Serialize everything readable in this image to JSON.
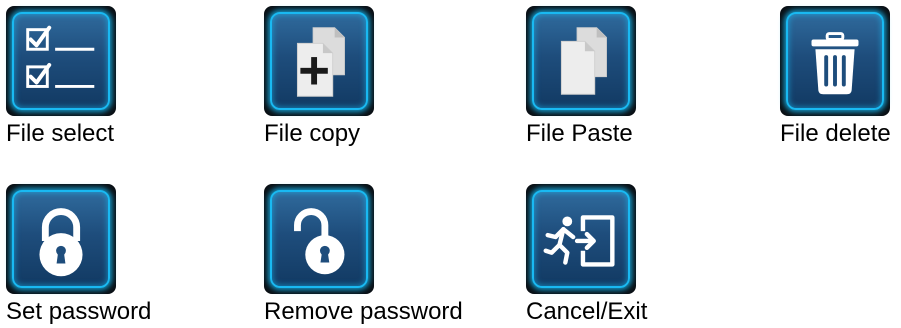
{
  "accent_color": "#19b9f2",
  "tile_color": "#1e4d7c",
  "icons": [
    {
      "label": "File select",
      "icon": "checklist-icon"
    },
    {
      "label": "File copy",
      "icon": "file-copy-icon"
    },
    {
      "label": "File Paste",
      "icon": "file-paste-icon"
    },
    {
      "label": "File delete",
      "icon": "trash-icon"
    },
    {
      "label": "Set password",
      "icon": "lock-closed-icon"
    },
    {
      "label": "Remove password",
      "icon": "lock-open-icon"
    },
    {
      "label": "Cancel/Exit",
      "icon": "exit-icon"
    }
  ]
}
